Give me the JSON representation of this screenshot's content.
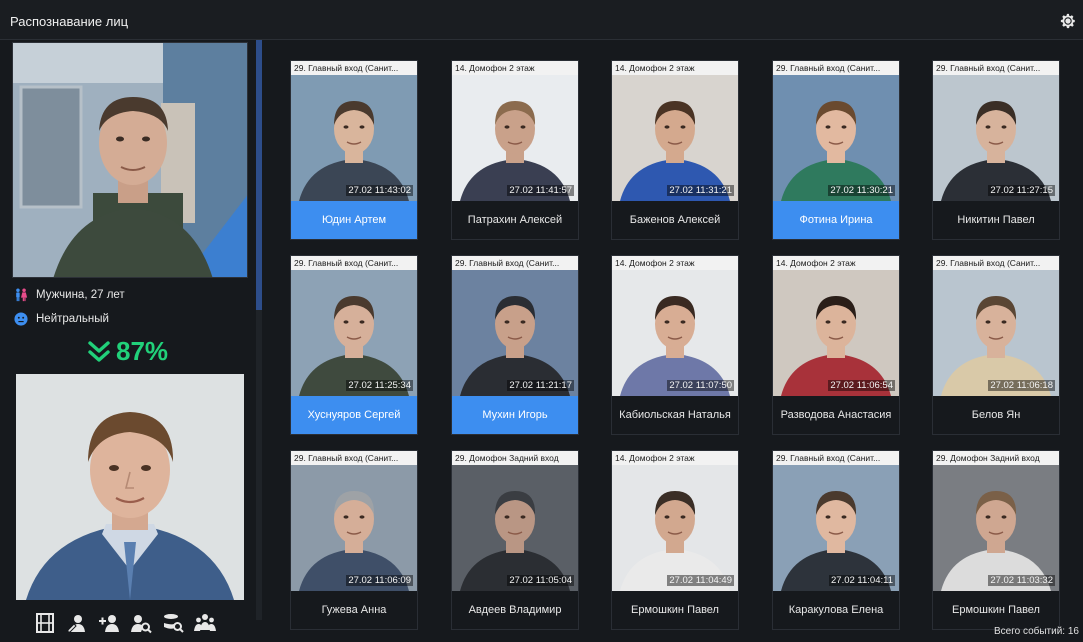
{
  "window": {
    "title": "Распознавание лиц"
  },
  "subject": {
    "gender_age": "Мужчина, 27 лет",
    "emotion": "Нейтральный",
    "match_score": "87%"
  },
  "toolbar": {
    "icons": [
      "film-icon",
      "edit-person-icon",
      "add-person-icon",
      "search-person-icon",
      "search-database-icon",
      "group-icon"
    ]
  },
  "events": [
    {
      "camera": "29. Главный вход (Санит...",
      "time": "27.02 11:43:02",
      "name": "Юдин Артем",
      "matched": true,
      "bg": "#7f9bb3",
      "skin": "#d9b59c",
      "shirt": "#3b4655",
      "hair": "#4a3a2e"
    },
    {
      "camera": "14. Домофон 2 этаж",
      "time": "27.02 11:41:57",
      "name": "Патрахин Алексей",
      "matched": false,
      "bg": "#e9ecef",
      "skin": "#c9a18a",
      "shirt": "#3a3f52",
      "hair": "#8b6b4e"
    },
    {
      "camera": "14. Домофон 2 этаж",
      "time": "27.02 11:31:21",
      "name": "Баженов Алексей",
      "matched": false,
      "bg": "#d8d4cf",
      "skin": "#d4a98e",
      "shirt": "#2e58b0",
      "hair": "#4a3324"
    },
    {
      "camera": "29. Главный вход (Санит...",
      "time": "27.02 11:30:21",
      "name": "Фотина Ирина",
      "matched": true,
      "bg": "#6f8fb0",
      "skin": "#e2b9a0",
      "shirt": "#2f7a5e",
      "hair": "#6a4a2f"
    },
    {
      "camera": "29. Главный вход (Санит...",
      "time": "27.02 11:27:15",
      "name": "Никитин Павел",
      "matched": false,
      "bg": "#bcc6ce",
      "skin": "#d7b39c",
      "shirt": "#2b2f36",
      "hair": "#3a2e26"
    },
    {
      "camera": "29. Главный вход (Санит...",
      "time": "27.02 11:25:34",
      "name": "Хуснуяров Сергей",
      "matched": true,
      "bg": "#8da2b5",
      "skin": "#d6b09a",
      "shirt": "#3f4a3e",
      "hair": "#4a3a2e"
    },
    {
      "camera": "29. Главный вход (Санит...",
      "time": "27.02 11:21:17",
      "name": "Мухин Игорь",
      "matched": true,
      "bg": "#6c82a0",
      "skin": "#c8a08a",
      "shirt": "#2a2d33",
      "hair": "#2a2d33"
    },
    {
      "camera": "14. Домофон 2 этаж",
      "time": "27.02 11:07:50",
      "name": "Кабиольская Наталья",
      "matched": false,
      "bg": "#e6e8ea",
      "skin": "#d8ad94",
      "shirt": "#6e78a8",
      "hair": "#3a2a22"
    },
    {
      "camera": "14. Домофон 2 этаж",
      "time": "27.02 11:06:54",
      "name": "Разводова Анастасия",
      "matched": false,
      "bg": "#cfc8c0",
      "skin": "#dcb49b",
      "shirt": "#a8323a",
      "hair": "#2a1e18"
    },
    {
      "camera": "29. Главный вход (Санит...",
      "time": "27.02 11:06:18",
      "name": "Белов Ян",
      "matched": false,
      "bg": "#b9c5cf",
      "skin": "#d8b29b",
      "shirt": "#d9c9a8",
      "hair": "#5a4634"
    },
    {
      "camera": "29. Главный вход (Санит...",
      "time": "27.02 11:06:09",
      "name": "Гужева Анна",
      "matched": false,
      "bg": "#8c9aa8",
      "skin": "#d5ae98",
      "shirt": "#3f4f68",
      "hair": "#9ea2a6"
    },
    {
      "camera": "29. Домофон Задний вход",
      "time": "27.02 11:05:04",
      "name": "Авдеев Владимир",
      "matched": false,
      "bg": "#5a5f66",
      "skin": "#b99684",
      "shirt": "#2b2e33",
      "hair": "#3a3d42"
    },
    {
      "camera": "14. Домофон 2 этаж",
      "time": "27.02 11:04:49",
      "name": "Ермошкин Павел",
      "matched": false,
      "bg": "#e4e6e8",
      "skin": "#d2a88f",
      "shirt": "#eaeaea",
      "hair": "#3a2e26"
    },
    {
      "camera": "29. Главный вход (Санит...",
      "time": "27.02 11:04:11",
      "name": "Каракулова Елена",
      "matched": false,
      "bg": "#8aa0b6",
      "skin": "#e0b8a0",
      "shirt": "#2d333b",
      "hair": "#4a3a2e"
    },
    {
      "camera": "29. Домофон Задний вход",
      "time": "27.02 11:03:32",
      "name": "Ермошкин Павел",
      "matched": false,
      "bg": "#7a7d82",
      "skin": "#cfa791",
      "shirt": "#dcdcdc",
      "hair": "#7a6048"
    }
  ],
  "footer": {
    "total": "Всего событий: 16"
  }
}
